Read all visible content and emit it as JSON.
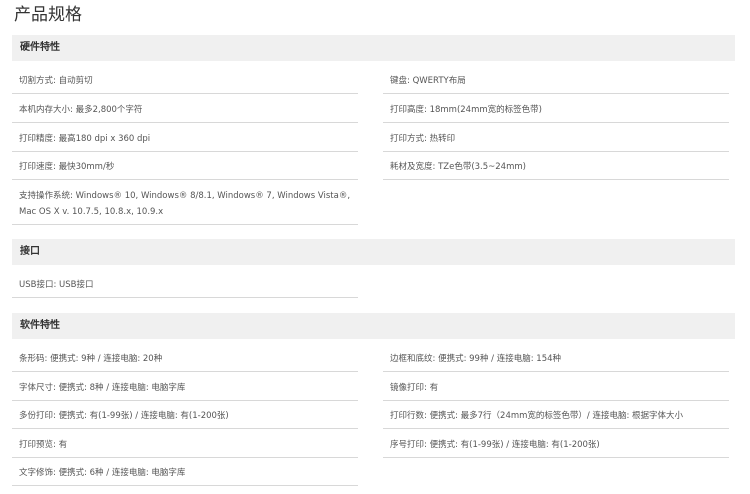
{
  "title": "产品规格",
  "sections": [
    {
      "header": "硬件特性",
      "left": [
        {
          "label": "切割方式:",
          "value": "自动剪切"
        },
        {
          "label": "本机内存大小:",
          "value": "最多2,800个字符"
        },
        {
          "label": "打印精度:",
          "value": "最高180 dpi x 360 dpi"
        },
        {
          "label": "打印速度:",
          "value": "最快30mm/秒"
        },
        {
          "label": "支持操作系统:",
          "value": "Windows® 10, Windows® 8/8.1, Windows® 7, Windows Vista®, Mac OS X v. 10.7.5, 10.8.x, 10.9.x"
        }
      ],
      "right": [
        {
          "label": "键盘:",
          "value": "QWERTY布局"
        },
        {
          "label": "打印高度:",
          "value": "18mm(24mm宽的标签色带)"
        },
        {
          "label": "打印方式:",
          "value": "热转印"
        },
        {
          "label": "耗材及宽度:",
          "value": "TZe色带(3.5~24mm)"
        }
      ]
    },
    {
      "header": "接口",
      "left": [
        {
          "label": "USB接口:",
          "value": "USB接口"
        }
      ],
      "right": []
    },
    {
      "header": "软件特性",
      "left": [
        {
          "label": "条形码:",
          "value": "便携式: 9种 / 连接电脑: 20种"
        },
        {
          "label": "字体尺寸:",
          "value": "便携式: 8种 / 连接电脑: 电脑字库"
        },
        {
          "label": "多份打印:",
          "value": "便携式: 有(1-99张) / 连接电脑: 有(1-200张)"
        },
        {
          "label": "打印预览:",
          "value": "有"
        },
        {
          "label": "文字修饰:",
          "value": "便携式: 6种 / 连接电脑: 电脑字库"
        }
      ],
      "right": [
        {
          "label": "边框和底纹:",
          "value": "便携式: 99种 / 连接电脑: 154种"
        },
        {
          "label": "镜像打印:",
          "value": "有"
        },
        {
          "label": "打印行数:",
          "value": "便携式: 最多7行（24mm宽的标签色带）/ 连接电脑: 根据字体大小"
        },
        {
          "label": "序号打印:",
          "value": "便携式: 有(1-99张) / 连接电脑: 有(1-200张)"
        }
      ]
    }
  ]
}
